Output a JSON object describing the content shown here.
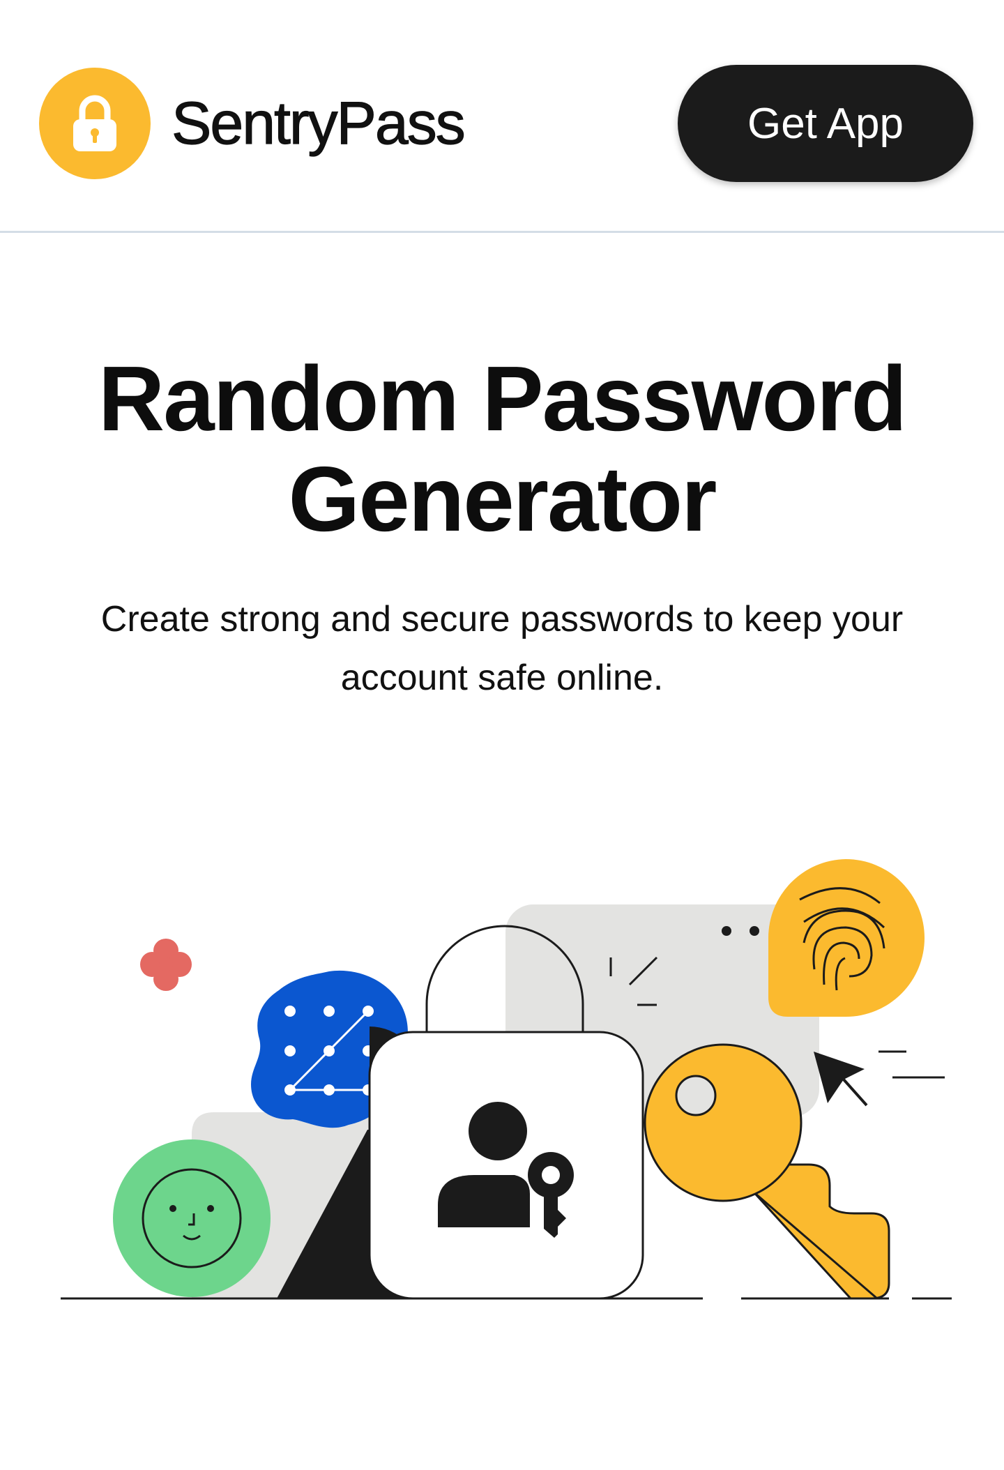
{
  "header": {
    "brand_name": "SentryPass",
    "cta_label": "Get App",
    "logo_icon": "padlock-icon"
  },
  "hero": {
    "title": "Random Password Generator",
    "subtitle": "Create strong and secure passwords to keep your account safe online."
  },
  "illustration": {
    "icons": [
      "flower-icon",
      "pattern-lock-icon",
      "face-icon",
      "padlock-icon",
      "user-key-icon",
      "key-icon",
      "fingerprint-icon",
      "cursor-icon"
    ]
  },
  "colors": {
    "brand_yellow": "#fbba2f",
    "dark": "#1b1b1b",
    "blue": "#0b57d0",
    "green": "#6dd58c",
    "red": "#e46962",
    "gray": "#e3e3e3"
  }
}
